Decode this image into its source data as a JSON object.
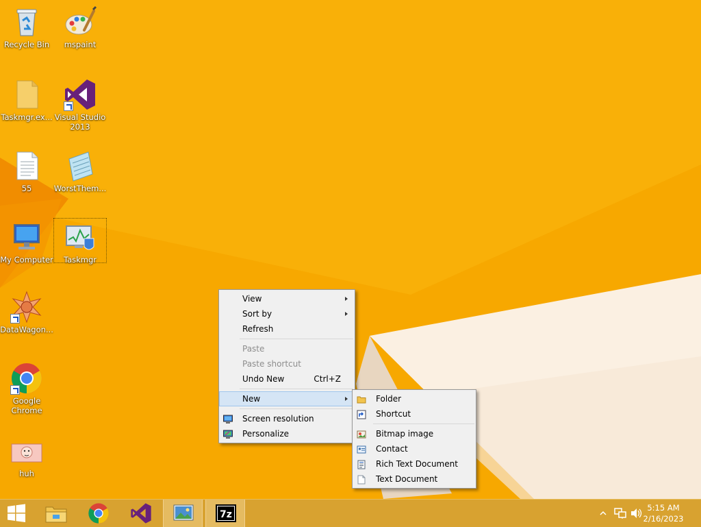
{
  "desktop": {
    "icons": [
      {
        "label": "Recycle Bin"
      },
      {
        "label": "mspaint"
      },
      {
        "label": "Taskmgr.ex..."
      },
      {
        "label": "Visual Studio 2013"
      },
      {
        "label": "55"
      },
      {
        "label": "WorstThem..."
      },
      {
        "label": "My Computer"
      },
      {
        "label": "Taskmgr"
      },
      {
        "label": "DataWagon..."
      },
      {
        "label": "Google Chrome"
      },
      {
        "label": "huh"
      }
    ]
  },
  "context_menu": {
    "items": [
      {
        "label": "View",
        "submenu": true
      },
      {
        "label": "Sort by",
        "submenu": true
      },
      {
        "label": "Refresh"
      },
      {
        "label": "Paste",
        "disabled": true
      },
      {
        "label": "Paste shortcut",
        "disabled": true
      },
      {
        "label": "Undo New",
        "shortcut": "Ctrl+Z"
      },
      {
        "label": "New",
        "submenu": true,
        "highlighted": true
      },
      {
        "label": "Screen resolution",
        "icon": "screen-resolution-icon"
      },
      {
        "label": "Personalize",
        "icon": "personalize-icon"
      }
    ]
  },
  "new_submenu": {
    "items": [
      {
        "label": "Folder",
        "icon": "folder-icon"
      },
      {
        "label": "Shortcut",
        "icon": "shortcut-icon"
      },
      {
        "label": "Bitmap image",
        "icon": "bitmap-icon"
      },
      {
        "label": "Contact",
        "icon": "contact-icon"
      },
      {
        "label": "Rich Text Document",
        "icon": "rich-text-icon"
      },
      {
        "label": "Text Document",
        "icon": "text-document-icon"
      }
    ]
  },
  "taskbar": {
    "buttons": [
      {
        "icon": "windows-start-icon"
      },
      {
        "icon": "file-explorer-icon"
      },
      {
        "icon": "chrome-icon"
      },
      {
        "icon": "visual-studio-icon"
      },
      {
        "icon": "image-viewer-icon"
      },
      {
        "icon": "7zip-icon"
      }
    ],
    "tray": {
      "time": "5:15 AM",
      "date": "2/16/2023"
    }
  },
  "colors": {
    "wallpaper": "#f7a800",
    "taskbar": "#d8a230",
    "menu_background": "#f0f0f0",
    "menu_highlight": "#d5e5f5"
  }
}
